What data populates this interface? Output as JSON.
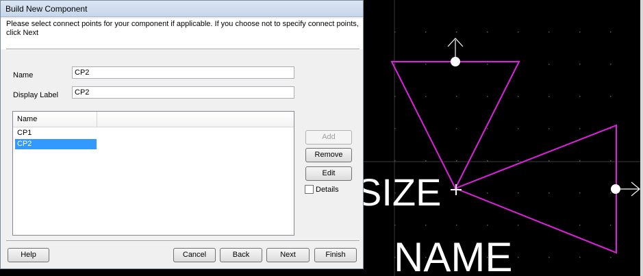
{
  "dialog": {
    "title": "Build New Component",
    "instructions": "Please select connect points for your component if applicable. If you choose not to specify connect points, click Next",
    "name_label": "Name",
    "name_value": "CP2",
    "display_label": "Display Label",
    "display_value": "CP2",
    "list_header": "Name",
    "list_items": [
      "CP1",
      "CP2"
    ],
    "selected_item": "CP2",
    "side_buttons": {
      "add": "Add",
      "remove": "Remove",
      "edit": "Edit"
    },
    "details_label": "Details",
    "footer": {
      "help": "Help",
      "cancel": "Cancel",
      "back": "Back",
      "next": "Next",
      "finish": "Finish"
    }
  },
  "canvas": {
    "background": "#000000",
    "shape_color": "#e020e0",
    "size_text": "SIZE",
    "name_text": "NAME"
  }
}
